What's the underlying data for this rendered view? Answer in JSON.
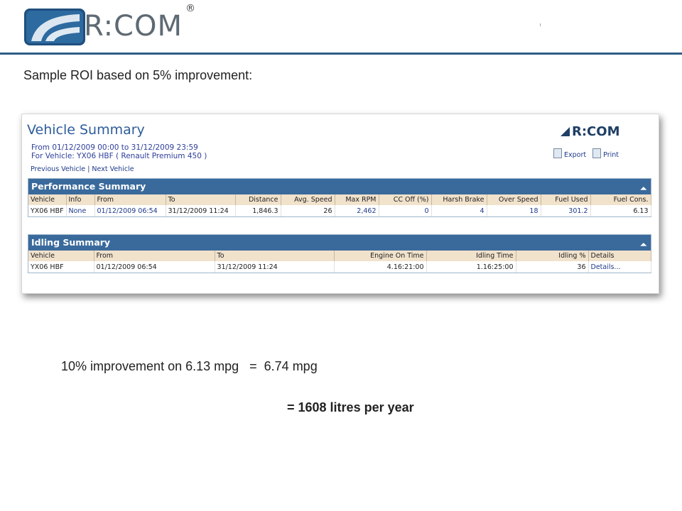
{
  "header": {
    "brand": "R:COM",
    "registered": "®",
    "brand_color": "#5e6a73",
    "rule_color": "#2e5d86"
  },
  "caption": "Sample ROI based on 5% improvement:",
  "report": {
    "title": "Vehicle Summary",
    "range": "From 01/12/2009 00:00 to 31/12/2009 23:59",
    "vehicle_line": "For Vehicle: YX06 HBF ( Renault Premium 450 )",
    "prev_vehicle": "Previous Vehicle",
    "separator": "|",
    "next_vehicle": "Next Vehicle",
    "logo_text": "R:COM",
    "export_label": "Export",
    "print_label": "Print",
    "performance": {
      "title": "Performance Summary",
      "headers": [
        "Vehicle",
        "Info",
        "From",
        "To",
        "Distance",
        "Avg. Speed",
        "Max RPM",
        "CC Off (%)",
        "Harsh Brake",
        "Over Speed",
        "Fuel Used",
        "Fuel Cons."
      ],
      "row": [
        "YX06 HBF",
        "None",
        "01/12/2009 06:54",
        "31/12/2009 11:24",
        "1,846.3",
        "26",
        "2,462",
        "0",
        "4",
        "18",
        "301.2",
        "6.13"
      ]
    },
    "idling": {
      "title": "Idling Summary",
      "headers": [
        "Vehicle",
        "From",
        "To",
        "Engine On Time",
        "Idling Time",
        "Idling %",
        "Details"
      ],
      "row": [
        "YX06 HBF",
        "01/12/2009 06:54",
        "31/12/2009 11:24",
        "4.16:21:00",
        "1.16:25:00",
        "36",
        "Details..."
      ]
    },
    "panel_color": "#3a6a9c",
    "header_row_color": "#f1e2cc"
  },
  "summary": {
    "line1": "10% improvement on 6.13 mpg   =  6.74 mpg",
    "line2": "= 1608 litres per year"
  }
}
